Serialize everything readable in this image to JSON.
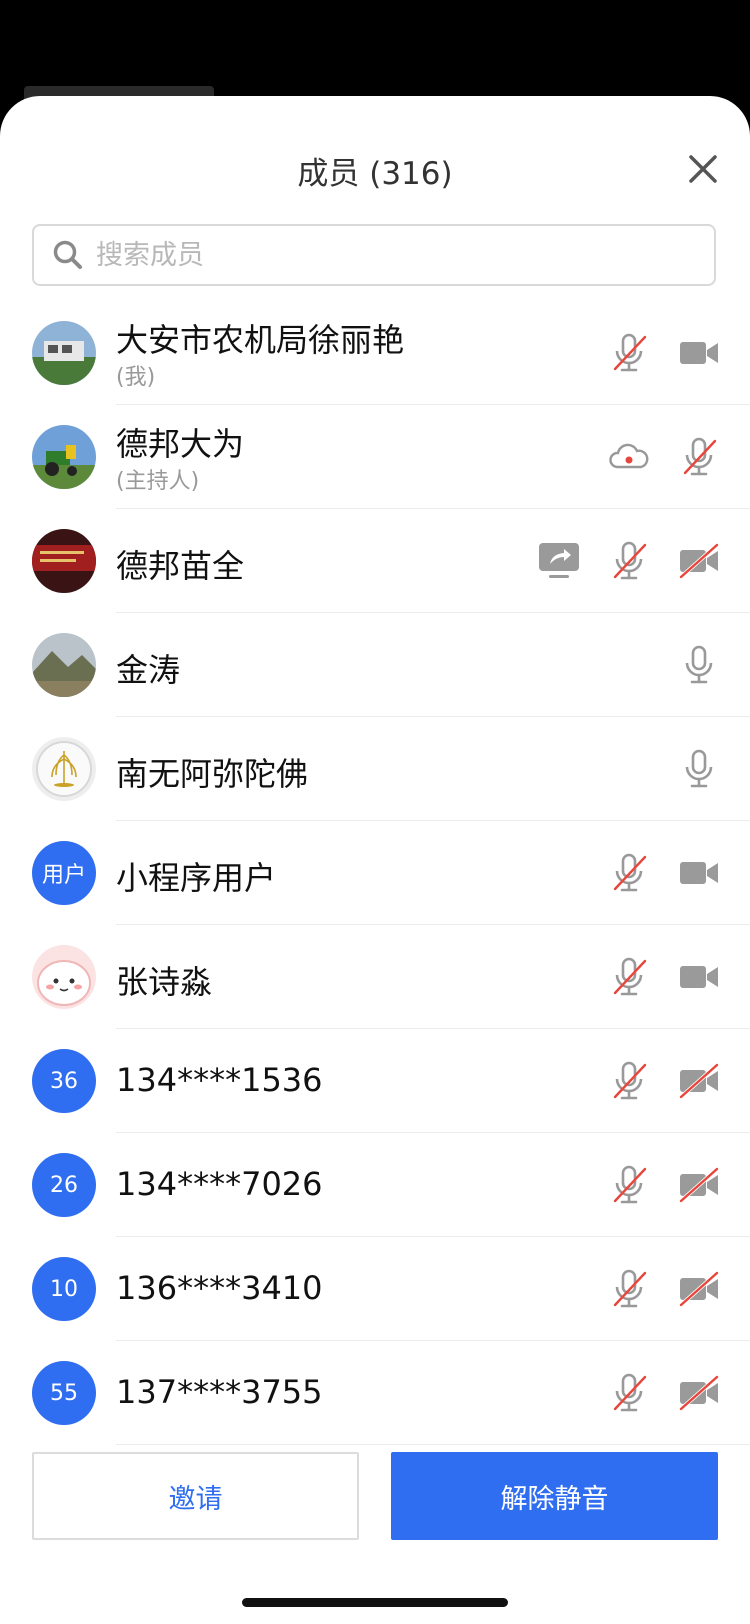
{
  "header": {
    "title": "成员 (316)"
  },
  "search": {
    "placeholder": "搜索成员"
  },
  "members": [
    {
      "name": "大安市农机局徐丽艳",
      "sub": "(我)",
      "avatar": "photo-house",
      "icons": [
        "mic-muted-icon",
        "video-icon"
      ]
    },
    {
      "name": "德邦大为",
      "sub": "(主持人)",
      "avatar": "photo-tractor",
      "icons": [
        "cloud-record-icon",
        "mic-muted-icon"
      ]
    },
    {
      "name": "德邦苗全",
      "sub": "",
      "avatar": "photo-banner",
      "icons": [
        "screen-share-icon",
        "mic-muted-icon",
        "video-off-icon"
      ]
    },
    {
      "name": "金涛",
      "sub": "",
      "avatar": "photo-mountain",
      "icons": [
        "mic-icon"
      ]
    },
    {
      "name": "南无阿弥陀佛",
      "sub": "",
      "avatar": "photo-willow",
      "icons": [
        "mic-icon"
      ]
    },
    {
      "name": "小程序用户",
      "sub": "",
      "avatar_text": "用户",
      "icons": [
        "mic-muted-icon",
        "video-icon"
      ]
    },
    {
      "name": "张诗淼",
      "sub": "",
      "avatar": "photo-pink-cartoon",
      "icons": [
        "mic-muted-icon",
        "video-icon"
      ]
    },
    {
      "name": "134****1536",
      "sub": "",
      "avatar_text": "36",
      "icons": [
        "mic-muted-icon",
        "video-off-icon"
      ]
    },
    {
      "name": "134****7026",
      "sub": "",
      "avatar_text": "26",
      "icons": [
        "mic-muted-icon",
        "video-off-icon"
      ]
    },
    {
      "name": "136****3410",
      "sub": "",
      "avatar_text": "10",
      "icons": [
        "mic-muted-icon",
        "video-off-icon"
      ]
    },
    {
      "name": "137****3755",
      "sub": "",
      "avatar_text": "55",
      "icons": [
        "mic-muted-icon",
        "video-off-icon"
      ]
    }
  ],
  "footer": {
    "invite_label": "邀请",
    "unmute_label": "解除静音"
  },
  "colors": {
    "accent": "#2f6ef0",
    "muted_red": "#e8453c",
    "icon_gray": "#999999"
  }
}
